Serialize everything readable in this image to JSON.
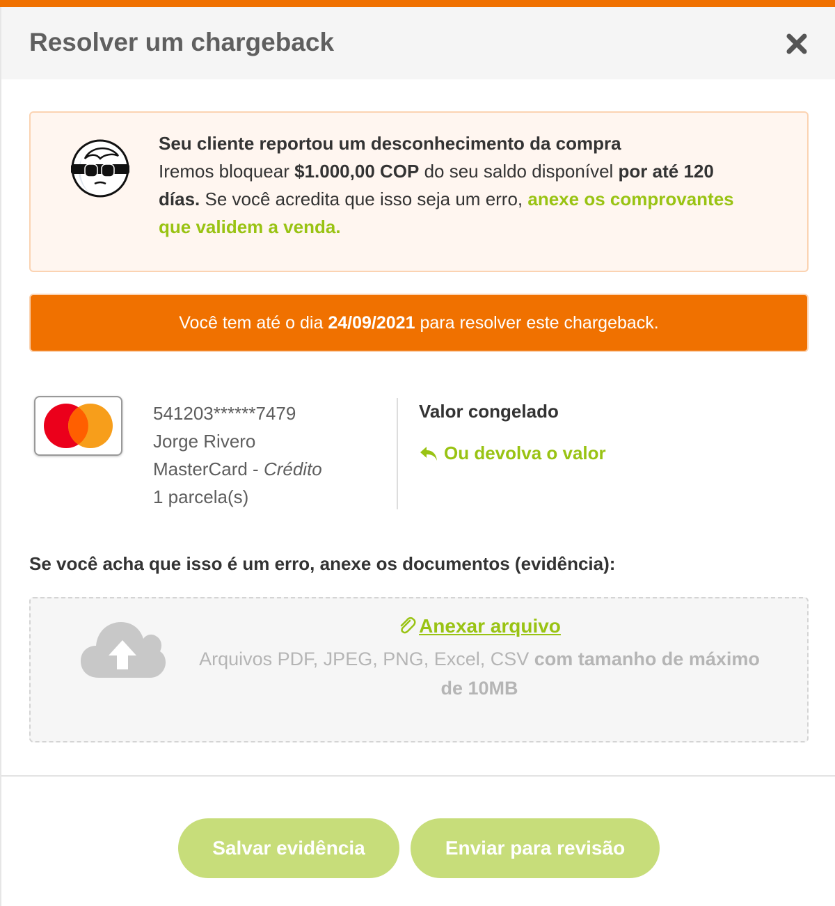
{
  "header": {
    "title": "Resolver um chargeback"
  },
  "alert": {
    "headline": "Seu cliente reportou um desconhecimento da compra",
    "text_1": "Iremos bloquear ",
    "amount": "$1.000,00 COP",
    "text_2": " do seu saldo disponível ",
    "period": "por até 120 días.",
    "text_3": " Se você acredita que isso seja um erro, ",
    "link": "anexe os comprovantes que validem a venda."
  },
  "deadline": {
    "prefix": "Você tem até o dia",
    "date": "24/09/2021",
    "suffix": "para resolver este chargeback."
  },
  "card": {
    "number": "541203******7479",
    "holder": "Jorge Rivero",
    "brand": "MasterCard",
    "separator": " - ",
    "type": "Crédito",
    "installments": "1 parcela(s)"
  },
  "status": {
    "label": "Valor congelado",
    "refund_link": "Ou devolva o valor"
  },
  "evidence": {
    "heading": "Se você acha que isso é um erro, anexe os documentos (evidência):",
    "attach_label": "Anexar arquivo",
    "hint_formats": "Arquivos PDF, JPEG, PNG, Excel, CSV",
    "hint_size": "com tamanho de máximo de 10MB"
  },
  "buttons": {
    "save": "Salvar evidência",
    "send": "Enviar para revisão"
  },
  "colors": {
    "accent_orange": "#f07100",
    "accent_green": "#99c313",
    "button_green": "#c7dd7a",
    "alert_bg": "#fff6f0"
  },
  "icons": [
    "close-icon",
    "thief-icon",
    "mastercard-logo",
    "reply-arrow-icon",
    "paperclip-icon",
    "cloud-upload-icon"
  ]
}
